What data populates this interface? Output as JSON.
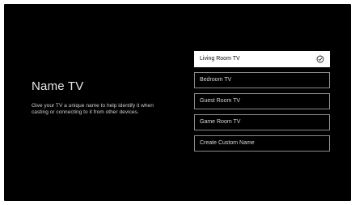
{
  "page": {
    "title": "Name TV",
    "description": "Give your TV a unique name to help identify it when casting or connecting to it from other devices."
  },
  "options": [
    {
      "label": "Living Room TV",
      "selected": true,
      "icon": "check-circle-icon"
    },
    {
      "label": "Bedroom TV",
      "selected": false
    },
    {
      "label": "Guest Room TV",
      "selected": false
    },
    {
      "label": "Game Room TV",
      "selected": false
    },
    {
      "label": "Create Custom Name",
      "selected": false
    }
  ],
  "colors": {
    "background": "#000000",
    "selected_bg": "#ffffff",
    "border": "#8a8a8a"
  }
}
